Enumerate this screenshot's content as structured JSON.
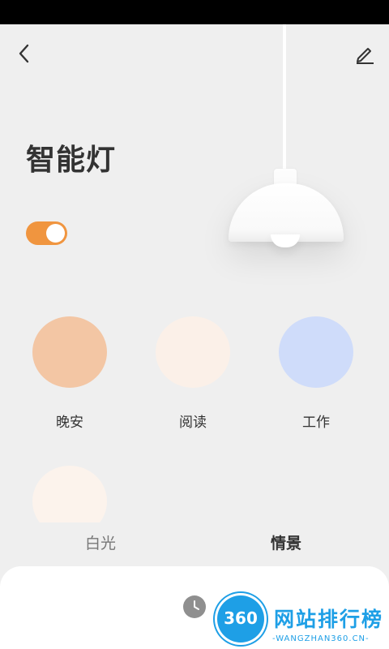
{
  "header": {
    "back_icon": "chevron-left-icon",
    "edit_icon": "pencil-icon",
    "title": "智能灯"
  },
  "power": {
    "on": true,
    "accent": "#f0953f"
  },
  "scenes": [
    {
      "label": "晚安",
      "color": "#f3c6a4"
    },
    {
      "label": "阅读",
      "color": "#fbf0e8"
    },
    {
      "label": "工作",
      "color": "#cfdcfa"
    },
    {
      "label": "",
      "color": "#fcf3ec"
    }
  ],
  "tabs": [
    {
      "label": "白光",
      "active": false
    },
    {
      "label": "情景",
      "active": true
    }
  ],
  "bottom_sheet": {
    "icon": "clock-icon"
  },
  "watermark": {
    "number": "360",
    "title": "网站排行榜",
    "subtitle": "-WANGZHAN360.CN-",
    "color": "#1e9fe6"
  }
}
